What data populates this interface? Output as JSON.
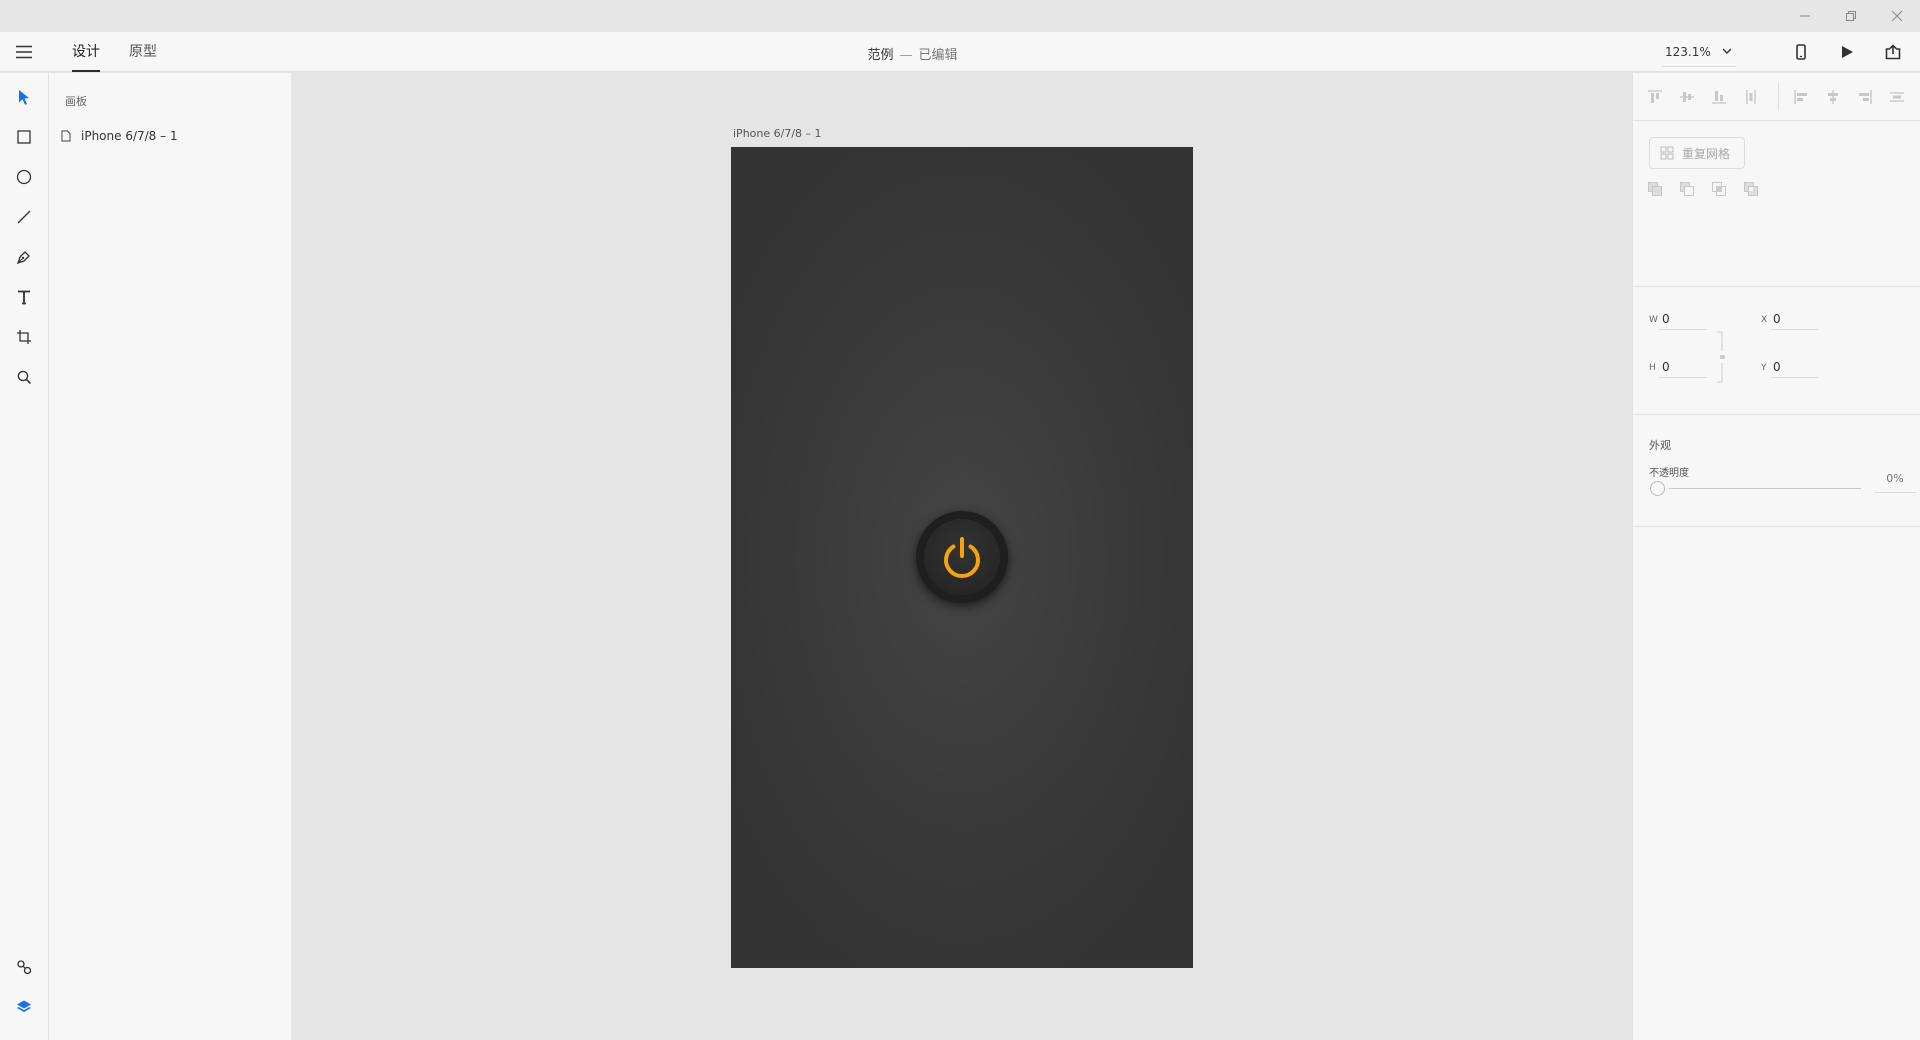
{
  "window": {
    "controls": [
      "minimize-icon",
      "restore-icon",
      "close-icon"
    ]
  },
  "header": {
    "menu_icon": "hamburger-icon",
    "tabs": [
      {
        "label": "设计",
        "active": true
      },
      {
        "label": "原型",
        "active": false
      }
    ],
    "doc_name": "范例",
    "separator": "—",
    "doc_status": "已编辑",
    "zoom": "123.1%",
    "right_icons": [
      "device-preview-icon",
      "play-icon",
      "share-icon"
    ]
  },
  "toolbar": {
    "tools": [
      "select-tool",
      "rectangle-tool",
      "ellipse-tool",
      "line-tool",
      "pen-tool",
      "text-tool",
      "artboard-tool",
      "zoom-tool"
    ],
    "bottom": [
      "symbols-icon",
      "layers-icon"
    ],
    "active_color": "#1473e6"
  },
  "layers": {
    "title": "画板",
    "items": [
      {
        "label": "iPhone 6/7/8 – 1"
      }
    ]
  },
  "canvas": {
    "artboard_label": "iPhone 6/7/8 – 1",
    "artboard_color": "#3a3a3a",
    "power_icon": "power-icon",
    "power_color": "#f5a40c"
  },
  "properties": {
    "repeat_grid_label": "重复网格",
    "width_label": "W",
    "width_value": "0",
    "height_label": "H",
    "height_value": "0",
    "x_label": "X",
    "x_value": "0",
    "y_label": "Y",
    "y_value": "0",
    "appearance_title": "外观",
    "opacity_label": "不透明度",
    "opacity_value": "0%"
  }
}
